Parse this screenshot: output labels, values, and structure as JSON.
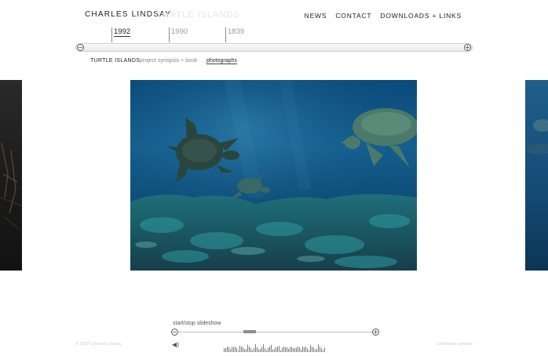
{
  "header": {
    "title": "CHARLES LINDSAY",
    "ghost_title": "TURTLE ISLANDS",
    "nav": [
      "NEWS",
      "CONTACT",
      "DOWNLOADS + LINKS"
    ]
  },
  "timeline": {
    "years": [
      "1992",
      "1990",
      "1839"
    ],
    "active_year": "1992",
    "zoom_out_icon": "minus-circle-icon",
    "zoom_in_icon": "plus-circle-icon"
  },
  "subnav": {
    "project": "TURTLE ISLANDS",
    "synopsis": "project synopsis + book",
    "photographs": "photographs"
  },
  "photo": {
    "description_icon": "sea-turtles-photo",
    "colors": {
      "water_top": "#1a5f8f",
      "water_deep": "#0a3b63",
      "reef": "#2c8a8f"
    }
  },
  "slideshow": {
    "label": "start/stop slideshow",
    "position": 0.35
  },
  "footer": {
    "copyright": "© 2007 Charles Lindsay",
    "credit": "a fantastic website"
  }
}
